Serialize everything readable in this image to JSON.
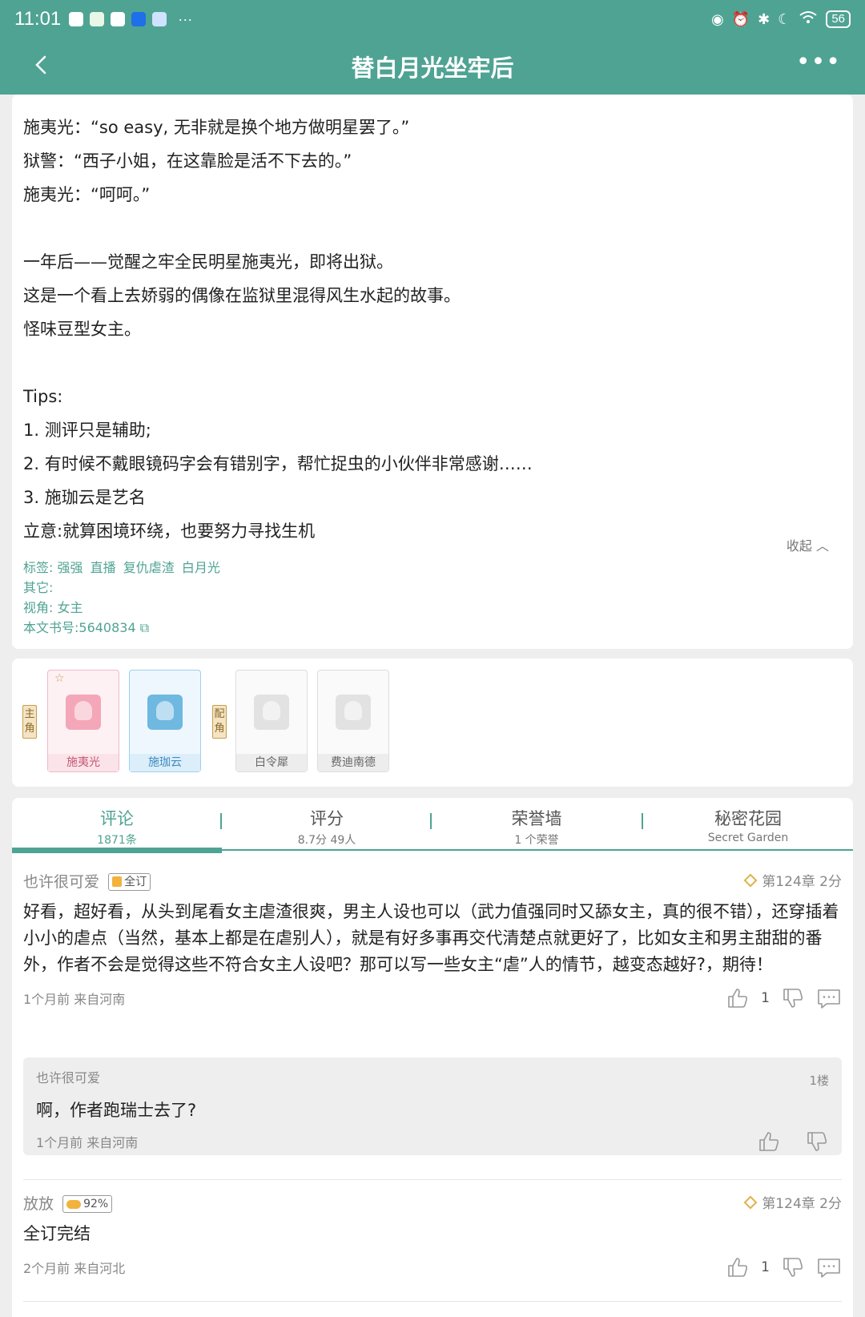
{
  "status_bar": {
    "time": "11:01",
    "battery": "56",
    "app_icons": [
      "qq-icon",
      "wechat-icon",
      "app-icon",
      "app-icon",
      "app-icon"
    ],
    "system_icons": [
      "eye-icon",
      "alarm-icon",
      "bluetooth-icon",
      "moon-icon",
      "wifi-icon"
    ]
  },
  "app_bar": {
    "title": "替白月光坐牢后"
  },
  "intro": {
    "lines": [
      "施夷光：“so easy, 无非就是换个地方做明星罢了。”",
      "狱警：“西子小姐，在这靠脸是活不下去的。”",
      "施夷光：“呵呵。”",
      "",
      "一年后——觉醒之牢全民明星施夷光，即将出狱。",
      "这是一个看上去娇弱的偶像在监狱里混得风生水起的故事。",
      "怪味豆型女主。",
      "",
      "Tips:",
      "1. 测评只是辅助;",
      "2. 有时候不戴眼镜码字会有错别字，帮忙捉虫的小伙伴非常感谢……",
      "3. 施珈云是艺名",
      "立意:就算困境环绕，也要努力寻找生机"
    ],
    "collapse_label": "收起",
    "tags_label": "标签:",
    "tags": [
      "强强",
      "直播",
      "复仇虐渣",
      "白月光"
    ],
    "other_label": "其它:",
    "perspective_label": "视角:",
    "perspective_value": "女主",
    "book_no": "本文书号:5640834"
  },
  "characters": {
    "main_tag": "主角",
    "support_tag": "配角",
    "main": [
      {
        "name": "施夷光",
        "color": "#f4a7b9"
      },
      {
        "name": "施珈云",
        "color": "#6fb8e0"
      }
    ],
    "support": [
      {
        "name": "白令犀",
        "color": "#cccccc"
      },
      {
        "name": "费迪南德",
        "color": "#cccccc"
      }
    ]
  },
  "tabs": [
    {
      "label": "评论",
      "sub": "1871条"
    },
    {
      "label": "评分",
      "sub": "8.7分 49人"
    },
    {
      "label": "荣誉墙",
      "sub": "1 个荣誉"
    },
    {
      "label": "秘密花园",
      "sub": "Secret Garden"
    }
  ],
  "comments": [
    {
      "user": "也许很可爱",
      "badge": "全订",
      "chapter": "第124章",
      "score": "2分",
      "body": "好看，超好看，从头到尾看女主虐渣很爽，男主人设也可以（武力值强同时又舔女主，真的很不错），还穿插着小小的虐点（当然，基本上都是在虐别人），就是有好多事再交代清楚点就更好了，比如女主和男主甜甜的番外，作者不会是觉得这些不符合女主人设吧？那可以写一些女主“虐”人的情节，越变态越好?，期待！",
      "time": "1个月前",
      "location": "来自河南",
      "likes": "1",
      "reply": {
        "user": "也许很可爱",
        "floor": "1楼",
        "body": "啊，作者跑瑞士去了?",
        "time": "1个月前",
        "location": "来自河南"
      }
    },
    {
      "user": "放放",
      "badge": "92%",
      "chapter": "第124章",
      "score": "2分",
      "body": "全订完结",
      "time": "2个月前",
      "location": "来自河北",
      "likes": "1"
    }
  ],
  "colors": {
    "brand": "#4fa393",
    "badge_gold": "#f2b33d"
  }
}
